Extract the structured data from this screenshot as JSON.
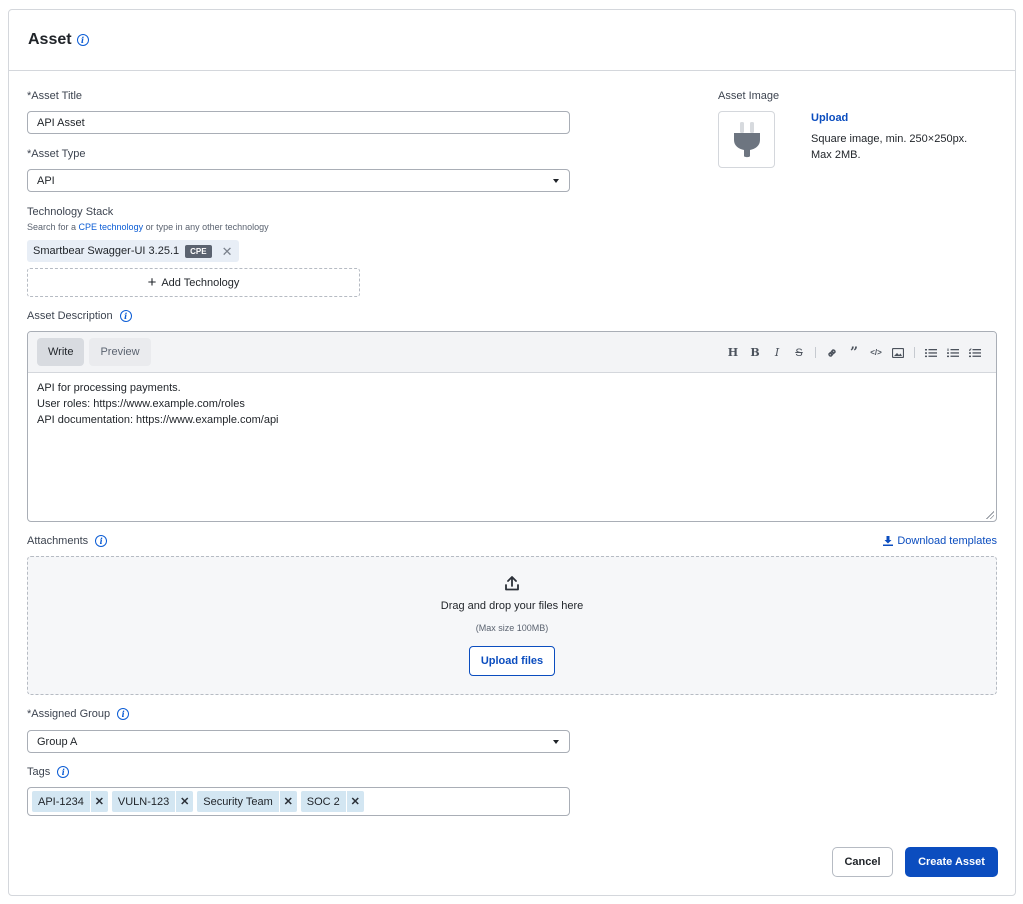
{
  "header": {
    "title": "Asset",
    "info_icon": "info-icon"
  },
  "asset_title": {
    "label": "*Asset Title",
    "value": "API Asset"
  },
  "asset_type": {
    "label": "*Asset Type",
    "value": "API"
  },
  "technology_stack": {
    "label": "Technology Stack",
    "hint_prefix": "Search for a ",
    "hint_link": "CPE technology",
    "hint_suffix": " or type in any other technology",
    "chips": [
      {
        "name": "Smartbear Swagger-UI 3.25.1",
        "badge": "CPE"
      }
    ],
    "add_label": "Add Technology"
  },
  "asset_image": {
    "label": "Asset Image",
    "icon": "plug-icon",
    "upload_label": "Upload",
    "hint_line1": "Square image, min. 250×250px.",
    "hint_line2": "Max 2MB."
  },
  "description": {
    "label": "Asset Description",
    "tabs": [
      {
        "label": "Write",
        "active": true
      },
      {
        "label": "Preview",
        "active": false
      }
    ],
    "toolbar": [
      "heading",
      "bold",
      "italic",
      "strikethrough",
      "link",
      "quote",
      "code",
      "image",
      "bulleted-list",
      "numbered-list",
      "task-list"
    ],
    "lines": [
      "API for processing payments.",
      "User roles: https://www.example.com/roles",
      "API documentation: https://www.example.com/api"
    ]
  },
  "attachments": {
    "label": "Attachments",
    "download_templates": "Download templates",
    "drop_text": "Drag and drop your files here",
    "max_size": "(Max size 100MB)",
    "upload_button": "Upload files"
  },
  "assigned_group": {
    "label": "*Assigned Group",
    "value": "Group A"
  },
  "tags": {
    "label": "Tags",
    "items": [
      "API-1234",
      "VULN-123",
      "Security Team",
      "SOC 2"
    ]
  },
  "footer": {
    "cancel_label": "Cancel",
    "create_label": "Create Asset"
  },
  "colors": {
    "primary": "#0b4dbf",
    "link": "#0b5cd5",
    "tag_bg": "#d3e6f2"
  }
}
